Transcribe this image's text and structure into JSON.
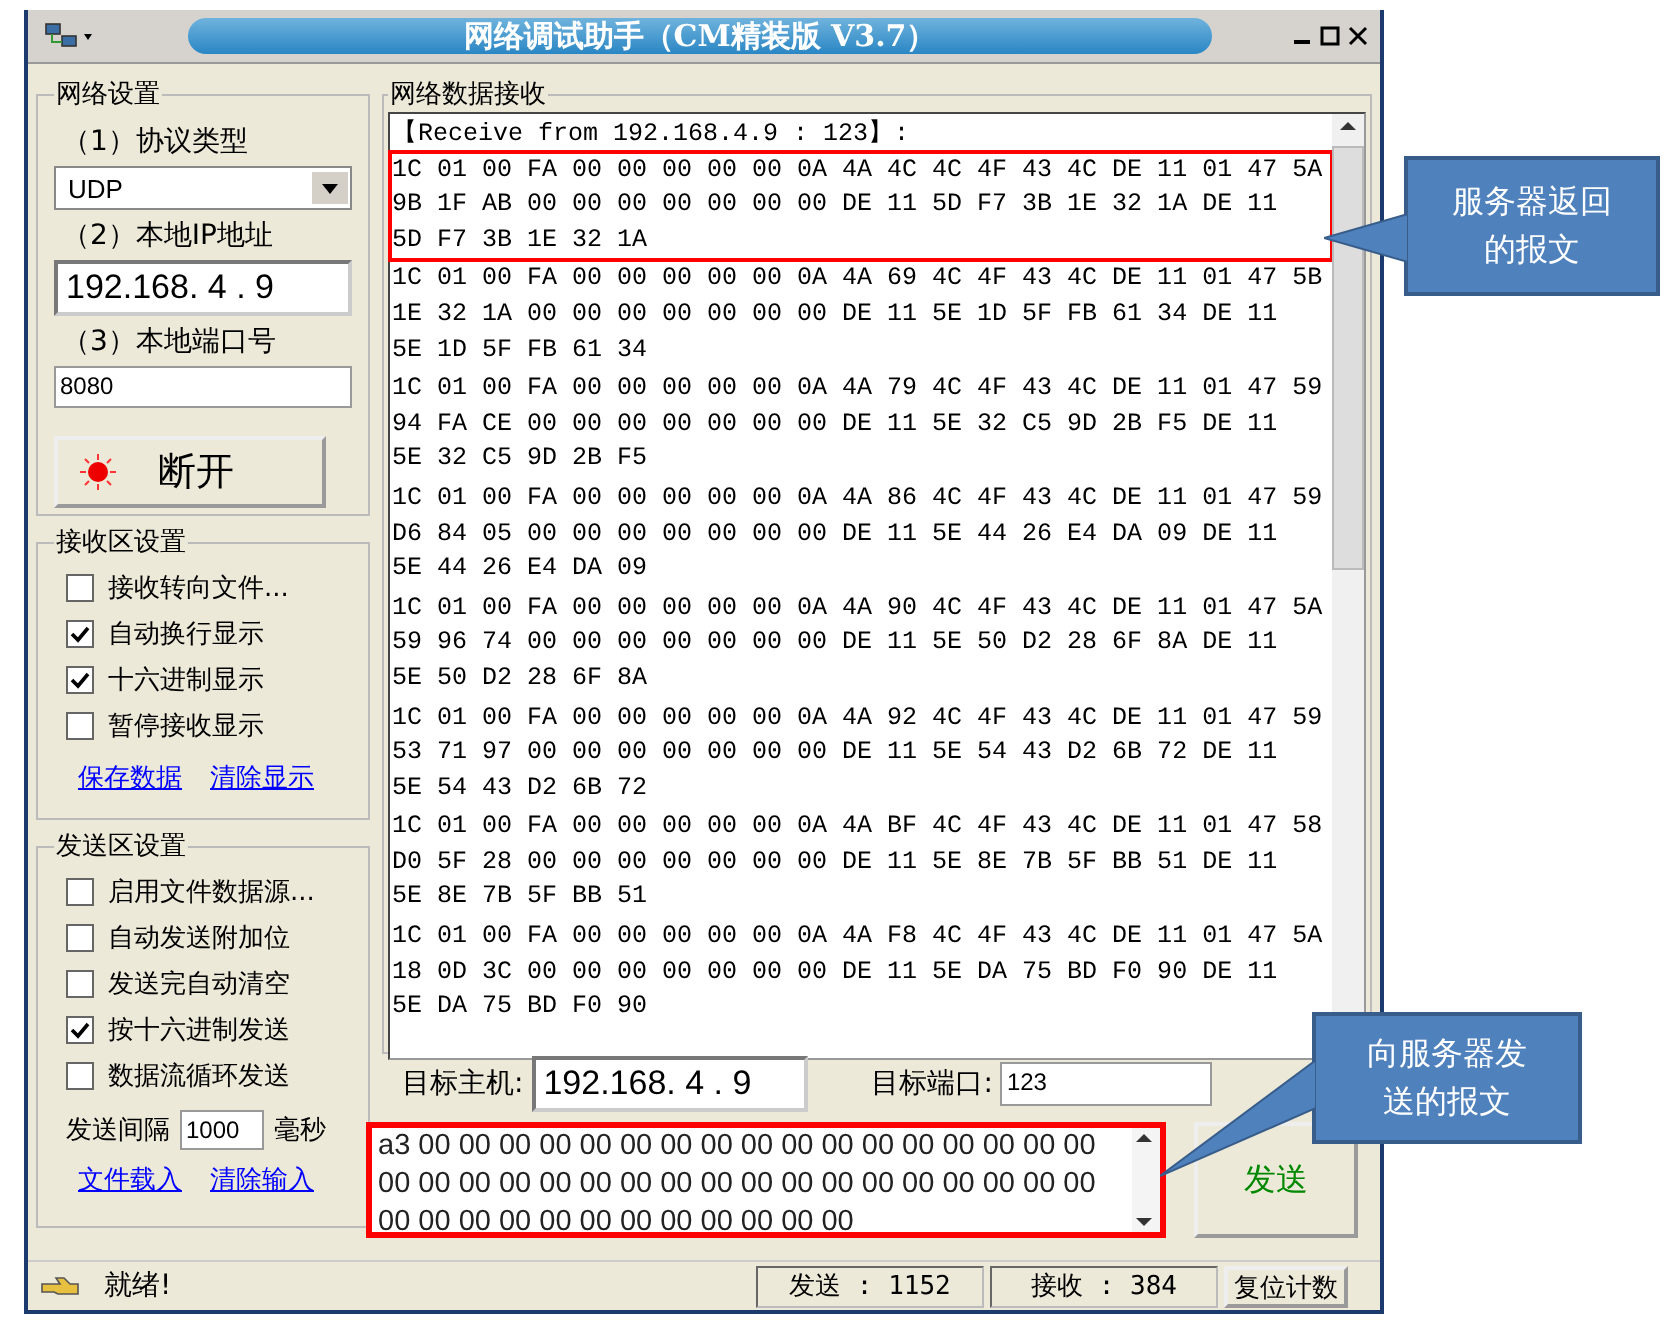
{
  "window": {
    "title": "网络调试助手（CM精装版 V3.7）"
  },
  "network_settings": {
    "title": "网络设置",
    "protocol_label": "（1）协议类型",
    "protocol": "UDP",
    "ip_label": "（2）本地IP地址",
    "ip": "192.168. 4 . 9",
    "port_label": "（3）本地端口号",
    "port": "8080",
    "connect_button": "断开",
    "connected": true
  },
  "receive_settings": {
    "title": "接收区设置",
    "options": [
      {
        "label": "接收转向文件...",
        "checked": false
      },
      {
        "label": "自动换行显示",
        "checked": true
      },
      {
        "label": "十六进制显示",
        "checked": true
      },
      {
        "label": "暂停接收显示",
        "checked": false
      }
    ],
    "links": [
      "保存数据",
      "清除显示"
    ]
  },
  "send_settings": {
    "title": "发送区设置",
    "options": [
      {
        "label": "启用文件数据源...",
        "checked": false
      },
      {
        "label": "自动发送附加位",
        "checked": false
      },
      {
        "label": "发送完自动清空",
        "checked": false
      },
      {
        "label": "按十六进制发送",
        "checked": true
      },
      {
        "label": "数据流循环发送",
        "checked": false
      }
    ],
    "interval_label": "发送间隔",
    "interval": "1000",
    "interval_unit": "毫秒",
    "links": [
      "文件载入",
      "清除输入"
    ]
  },
  "receive": {
    "title": "网络数据接收",
    "header": "【Receive from 192.168.4.9 : 123】:",
    "packets": [
      {
        "highlighted": true,
        "lines": [
          "1C 01 00 FA 00 00 00 00 00 0A 4A 4C 4C 4F 43 4C DE 11 01 47 5A",
          "9B 1F AB 00 00 00 00 00 00 00 DE 11 5D F7 3B 1E 32 1A DE 11",
          "5D F7 3B 1E 32 1A"
        ]
      },
      {
        "highlighted": false,
        "lines": [
          "1C 01 00 FA 00 00 00 00 00 0A 4A 69 4C 4F 43 4C DE 11 01 47 5B",
          "1E 32 1A 00 00 00 00 00 00 00 DE 11 5E 1D 5F FB 61 34 DE 11",
          "5E 1D 5F FB 61 34"
        ]
      },
      {
        "highlighted": false,
        "lines": [
          "1C 01 00 FA 00 00 00 00 00 0A 4A 79 4C 4F 43 4C DE 11 01 47 59",
          "94 FA CE 00 00 00 00 00 00 00 DE 11 5E 32 C5 9D 2B F5 DE 11",
          "5E 32 C5 9D 2B F5"
        ]
      },
      {
        "highlighted": false,
        "lines": [
          "1C 01 00 FA 00 00 00 00 00 0A 4A 86 4C 4F 43 4C DE 11 01 47 59",
          "D6 84 05 00 00 00 00 00 00 00 DE 11 5E 44 26 E4 DA 09 DE 11",
          "5E 44 26 E4 DA 09"
        ]
      },
      {
        "highlighted": false,
        "lines": [
          "1C 01 00 FA 00 00 00 00 00 0A 4A 90 4C 4F 43 4C DE 11 01 47 5A",
          "59 96 74 00 00 00 00 00 00 00 DE 11 5E 50 D2 28 6F 8A DE 11",
          "5E 50 D2 28 6F 8A"
        ]
      },
      {
        "highlighted": false,
        "lines": [
          "1C 01 00 FA 00 00 00 00 00 0A 4A 92 4C 4F 43 4C DE 11 01 47 59",
          "53 71 97 00 00 00 00 00 00 00 DE 11 5E 54 43 D2 6B 72 DE 11",
          "5E 54 43 D2 6B 72"
        ]
      },
      {
        "highlighted": false,
        "lines": [
          "1C 01 00 FA 00 00 00 00 00 0A 4A BF 4C 4F 43 4C DE 11 01 47 58",
          "D0 5F 28 00 00 00 00 00 00 00 DE 11 5E 8E 7B 5F BB 51 DE 11",
          "5E 8E 7B 5F BB 51"
        ]
      },
      {
        "highlighted": false,
        "lines": [
          "1C 01 00 FA 00 00 00 00 00 0A 4A F8 4C 4F 43 4C DE 11 01 47 5A",
          "18 0D 3C 00 00 00 00 00 00 00 DE 11 5E DA 75 BD F0 90 DE 11",
          "5E DA 75 BD F0 90"
        ]
      }
    ]
  },
  "target": {
    "host_label": "目标主机:",
    "host": "192.168. 4 . 9",
    "port_label": "目标端口:",
    "port": "123"
  },
  "send": {
    "highlighted": true,
    "lines": [
      "a3 00 00 00 00 00 00 00 00 00 00 00 00 00 00 00 00 00",
      "00 00 00 00 00 00 00 00 00 00 00 00 00 00 00 00 00 00",
      "00 00 00 00 00 00 00 00 00 00 00 00"
    ],
    "button": "发送"
  },
  "status_bar": {
    "message": "就绪!",
    "sent": "发送 : 1152",
    "received": "接收 : 384",
    "reset_button": "复位计数"
  },
  "callouts": [
    {
      "text": "服务器返回的报文"
    },
    {
      "text": "向服务器发送的报文"
    }
  ]
}
